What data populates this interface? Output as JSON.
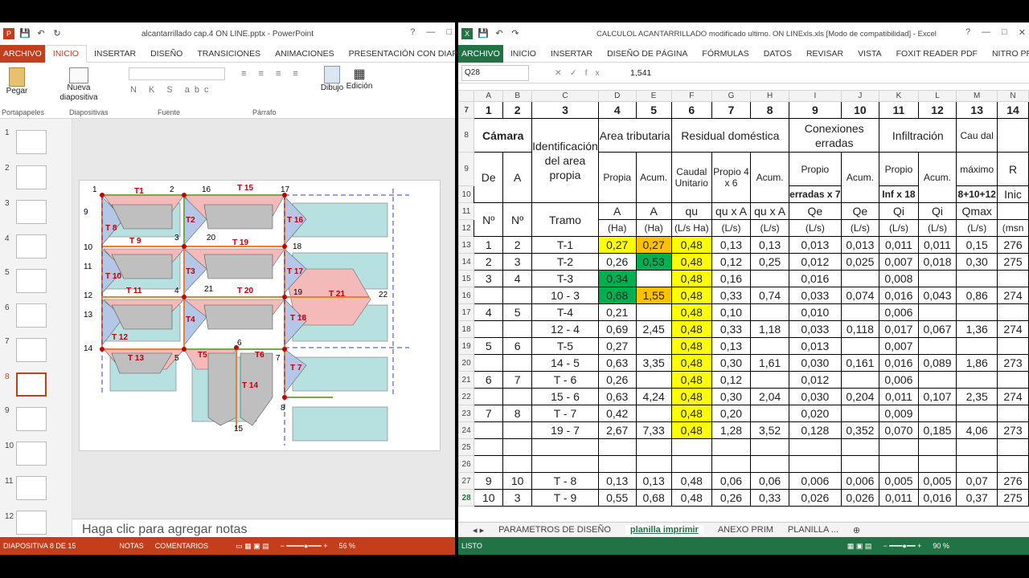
{
  "powerpoint": {
    "title": "alcantarrillado cap.4 ON LINE.pptx - PowerPoint",
    "tabs": [
      "ARCHIVO",
      "INICIO",
      "INSERTAR",
      "DISEÑO",
      "TRANSICIONES",
      "ANIMACIONES",
      "PRESENTACIÓN CON DIAPOSITIVAS"
    ],
    "ribbon": {
      "paste": "Pegar",
      "new_slide": "Nueva diapositiva",
      "draw": "Dibujo",
      "edit": "Edición",
      "g1": "Portapapeles",
      "g2": "Diapositivas",
      "g3": "Fuente",
      "g4": "Párrafo"
    },
    "thumb_numbers": [
      "1",
      "2",
      "3",
      "4",
      "5",
      "6",
      "7",
      "8",
      "9",
      "10",
      "11",
      "12"
    ],
    "notes_placeholder": "Haga clic para agregar notas",
    "status": {
      "slide": "DIAPOSITIVA 8 DE 15",
      "notes": "NOTAS",
      "comments": "COMENTARIOS",
      "zoom": "56 %"
    },
    "slide": {
      "nodes": [
        "1",
        "2",
        "16",
        "17",
        "9",
        "3",
        "20",
        "18",
        "10",
        "11",
        "4",
        "21",
        "19",
        "22",
        "12",
        "13",
        "5",
        "6",
        "7",
        "14",
        "15",
        "8"
      ],
      "tramos": [
        "T1",
        "T 15",
        "T2",
        "T 9",
        "T 16",
        "T 8",
        "T 19",
        "T 17",
        "T3",
        "T 11",
        "T 20",
        "T 21",
        "T 10",
        "T4",
        "T 18",
        "T 12",
        "T5",
        "T6",
        "T 13",
        "T 14",
        "T 7"
      ]
    }
  },
  "excel": {
    "title": "CALCULOL ACANTARRILLADO modificado ultimo. ON LINExls.xls  [Modo de compatibilidad] - Excel",
    "tabs": [
      "ARCHIVO",
      "INICIO",
      "INSERTAR",
      "DISEÑO DE PÁGINA",
      "FÓRMULAS",
      "DATOS",
      "REVISAR",
      "VISTA",
      "FOXIT READER PDF",
      "NITRO PRO 10"
    ],
    "namebox": "Q28",
    "formula_value": "1,541",
    "columns": [
      "",
      "A",
      "B",
      "C",
      "D",
      "E",
      "F",
      "G",
      "H",
      "I",
      "J",
      "K",
      "L",
      "M",
      "N"
    ],
    "header_row7": [
      "1",
      "2",
      "3",
      "4",
      "5",
      "6",
      "7",
      "8",
      "9",
      "10",
      "11",
      "12",
      "13",
      "14"
    ],
    "header_texts": {
      "camara": "Cámara",
      "ident": "Identificación del area propia",
      "area_trib": "Area tributaria",
      "resid": "Residual doméstica",
      "conex": "Conexiones erradas",
      "infil": "Infiltración",
      "caudal": "Cau dal",
      "de": "De",
      "a": "A",
      "propia": "Propia",
      "acum": "Acum.",
      "caudal_unit": "Caudal Unitario",
      "propio46": "Propio 4 x 6",
      "acum2": "Acum.",
      "propio_err": "Propio",
      "erradas": "erradas x 7",
      "acum3": "Acum.",
      "propio_inf": "Propio",
      "inf18": "Inf x 18",
      "acum4": "Acum.",
      "maximo": "máximo",
      "suma": "8+10+12",
      "r": "R",
      "inic": "Inic",
      "no": "Nº",
      "no2": "Nº",
      "tramo": "Tramo",
      "A": "A",
      "A2": "A",
      "qu": "qu",
      "quA": "qu x A",
      "quA2": "qu x A",
      "Qe": "Qe",
      "Qe2": "Qe",
      "Qi": "Qi",
      "Qi2": "Qi",
      "Qmax": "Qmax",
      "u1": "(Ha)",
      "u2": "(Ha)",
      "u3": "(L/s Ha)",
      "u4": "(L/s)",
      "u5": "(L/s)",
      "u6": "(L/s)",
      "u7": "(L/s)",
      "u8": "(L/s)",
      "u9": "(L/s)",
      "u10": "(L/s)",
      "u11": "(msn"
    },
    "rows": [
      {
        "n": "13",
        "c": [
          "1",
          "2",
          "T-1",
          "0,27",
          "0,27",
          "0,48",
          "0,13",
          "0,13",
          "0,013",
          "0,013",
          "0,011",
          "0,011",
          "0,15",
          "276"
        ]
      },
      {
        "n": "14",
        "c": [
          "2",
          "3",
          "T-2",
          "0,26",
          "0,53",
          "0,48",
          "0,12",
          "0,25",
          "0,012",
          "0,025",
          "0,007",
          "0,018",
          "0,30",
          "275"
        ]
      },
      {
        "n": "15",
        "c": [
          "3",
          "4",
          "T-3",
          "0,34",
          "",
          "0,48",
          "0,16",
          "",
          "0,016",
          "",
          "0,008",
          "",
          "",
          ""
        ]
      },
      {
        "n": "16",
        "c": [
          "",
          "",
          "10 -  3",
          "0,68",
          "1,55",
          "0,48",
          "0,33",
          "0,74",
          "0,033",
          "0,074",
          "0,016",
          "0,043",
          "0,86",
          "274"
        ]
      },
      {
        "n": "17",
        "c": [
          "4",
          "5",
          "T-4",
          "0,21",
          "",
          "0,48",
          "0,10",
          "",
          "0,010",
          "",
          "0,006",
          "",
          "",
          ""
        ]
      },
      {
        "n": "18",
        "c": [
          "",
          "",
          "12 -  4",
          "0,69",
          "2,45",
          "0,48",
          "0,33",
          "1,18",
          "0,033",
          "0,118",
          "0,017",
          "0,067",
          "1,36",
          "274"
        ]
      },
      {
        "n": "19",
        "c": [
          "5",
          "6",
          "T-5",
          "0,27",
          "",
          "0,48",
          "0,13",
          "",
          "0,013",
          "",
          "0,007",
          "",
          "",
          ""
        ]
      },
      {
        "n": "20",
        "c": [
          "",
          "",
          "14 - 5",
          "0,63",
          "3,35",
          "0,48",
          "0,30",
          "1,61",
          "0,030",
          "0,161",
          "0,016",
          "0,089",
          "1,86",
          "273"
        ]
      },
      {
        "n": "21",
        "c": [
          "6",
          "7",
          "T - 6",
          "0,26",
          "",
          "0,48",
          "0,12",
          "",
          "0,012",
          "",
          "0,006",
          "",
          "",
          ""
        ]
      },
      {
        "n": "22",
        "c": [
          "",
          "",
          "15 - 6",
          "0,63",
          "4,24",
          "0,48",
          "0,30",
          "2,04",
          "0,030",
          "0,204",
          "0,011",
          "0,107",
          "2,35",
          "274"
        ]
      },
      {
        "n": "23",
        "c": [
          "7",
          "8",
          "T - 7",
          "0,42",
          "",
          "0,48",
          "0,20",
          "",
          "0,020",
          "",
          "0,009",
          "",
          "",
          ""
        ]
      },
      {
        "n": "24",
        "c": [
          "",
          "",
          "19 - 7",
          "2,67",
          "7,33",
          "0,48",
          "1,28",
          "3,52",
          "0,128",
          "0,352",
          "0,070",
          "0,185",
          "4,06",
          "273"
        ]
      },
      {
        "n": "25",
        "c": [
          "",
          "",
          "",
          "",
          "",
          "",
          "",
          "",
          "",
          "",
          "",
          "",
          "",
          ""
        ]
      },
      {
        "n": "26",
        "c": [
          "",
          "",
          "",
          "",
          "",
          "",
          "",
          "",
          "",
          "",
          "",
          "",
          "",
          ""
        ]
      },
      {
        "n": "27",
        "c": [
          "9",
          "10",
          "T - 8",
          "0,13",
          "0,13",
          "0,48",
          "0,06",
          "0,06",
          "0,006",
          "0,006",
          "0,005",
          "0,005",
          "0,07",
          "276"
        ]
      },
      {
        "n": "28",
        "c": [
          "10",
          "3",
          "T - 9",
          "0,55",
          "0,68",
          "0,48",
          "0,26",
          "0,33",
          "0,026",
          "0,026",
          "0,011",
          "0,016",
          "0,37",
          "275"
        ]
      }
    ],
    "sheet_tabs": [
      "PARAMETROS DE DISEÑO",
      "planilla  imprimir",
      "ANEXO PRIM",
      "PLANILLA  ..."
    ],
    "status": {
      "ready": "LISTO",
      "zoom": "90 %"
    }
  }
}
